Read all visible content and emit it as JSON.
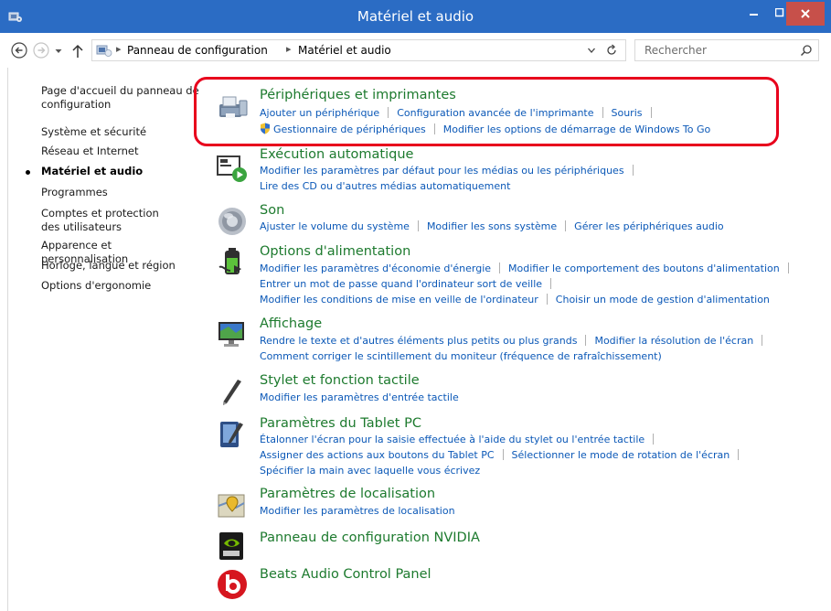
{
  "window": {
    "title": "Matériel et audio"
  },
  "address": {
    "crumbs": [
      "Panneau de configuration",
      "Matériel et audio"
    ],
    "search_placeholder": "Rechercher"
  },
  "leftnav": {
    "items": [
      {
        "label": "Page d'accueil du panneau de configuration"
      },
      {
        "label": "Système et sécurité"
      },
      {
        "label": "Réseau et Internet"
      },
      {
        "label": "Matériel et audio"
      },
      {
        "label": "Programmes"
      },
      {
        "label": "Comptes et protection des utilisateurs"
      },
      {
        "label": "Apparence et personnalisation"
      },
      {
        "label": "Horloge, langue et région"
      },
      {
        "label": "Options d'ergonomie"
      }
    ]
  },
  "categories": {
    "devices": {
      "title": "Périphériques et imprimantes",
      "links": [
        "Ajouter un périphérique",
        "Configuration avancée de l'imprimante",
        "Souris",
        "Gestionnaire de périphériques",
        "Modifier les options de démarrage de Windows To Go"
      ]
    },
    "autoplay": {
      "title": "Exécution automatique",
      "links": [
        "Modifier les paramètres par défaut pour les médias ou les périphériques",
        "Lire des CD ou d'autres médias automatiquement"
      ]
    },
    "sound": {
      "title": "Son",
      "links": [
        "Ajuster le volume du système",
        "Modifier les sons système",
        "Gérer les périphériques audio"
      ]
    },
    "power": {
      "title": "Options d'alimentation",
      "links": [
        "Modifier les paramètres d'économie d'énergie",
        "Modifier le comportement des boutons d'alimentation",
        "Entrer un mot de passe quand l'ordinateur sort de veille",
        "Modifier les conditions de mise en veille de l'ordinateur",
        "Choisir un mode de gestion d'alimentation"
      ]
    },
    "display": {
      "title": "Affichage",
      "links": [
        "Rendre le texte et d'autres éléments plus petits ou plus grands",
        "Modifier la résolution de l'écran",
        "Comment corriger le scintillement du moniteur (fréquence de rafraîchissement)"
      ]
    },
    "pen": {
      "title": "Stylet et fonction tactile",
      "links": [
        "Modifier les paramètres d'entrée tactile"
      ]
    },
    "tablet": {
      "title": "Paramètres du Tablet PC",
      "links": [
        "Étalonner l'écran pour la saisie effectuée à l'aide du stylet ou l'entrée tactile",
        "Assigner des actions aux boutons du Tablet PC",
        "Sélectionner le mode de rotation de l'écran",
        "Spécifier la main avec laquelle vous écrivez"
      ]
    },
    "location": {
      "title": "Paramètres de localisation",
      "links": [
        "Modifier les paramètres de localisation"
      ]
    },
    "nvidia": {
      "title": "Panneau de configuration NVIDIA"
    },
    "beats": {
      "title": "Beats Audio Control Panel"
    }
  },
  "colors": {
    "titlebar": "#2b6cc4",
    "category_title": "#1d7a2e",
    "link": "#0b58b7",
    "highlight": "#e8001c"
  }
}
